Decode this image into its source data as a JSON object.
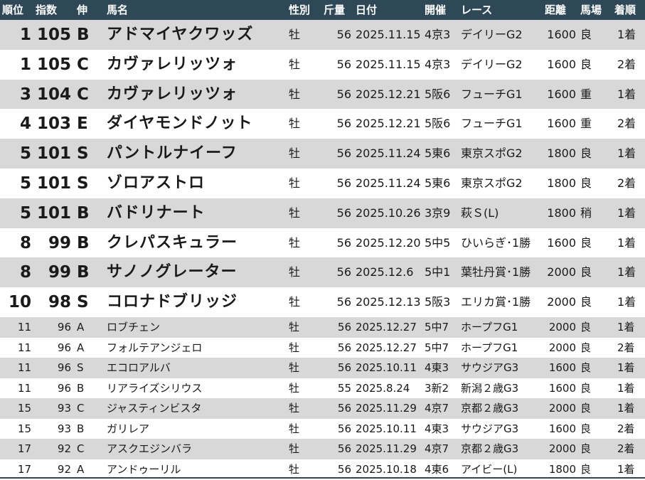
{
  "headers": {
    "rank": "順位",
    "index": "指数",
    "grade": "伸",
    "name": "馬名",
    "sex": "性別",
    "weight": "斤量",
    "date": "日付",
    "venue": "開催",
    "race": "レース",
    "distance": "距離",
    "track": "馬場",
    "finish": "着順"
  },
  "rows": [
    {
      "rank": "1",
      "index": "105",
      "grade": "B",
      "name": "アドマイヤクワッズ",
      "sex": "牡",
      "weight": "56",
      "date": "2025.11.15",
      "venue": "4京3",
      "race": "デイリーG2",
      "distance": "1600",
      "track": "良",
      "finish": "1着"
    },
    {
      "rank": "1",
      "index": "105",
      "grade": "C",
      "name": "カヴァレリッツォ",
      "sex": "牡",
      "weight": "56",
      "date": "2025.11.15",
      "venue": "4京3",
      "race": "デイリーG2",
      "distance": "1600",
      "track": "良",
      "finish": "2着"
    },
    {
      "rank": "3",
      "index": "104",
      "grade": "C",
      "name": "カヴァレリッツォ",
      "sex": "牡",
      "weight": "56",
      "date": "2025.12.21",
      "venue": "5阪6",
      "race": "フューチG1",
      "distance": "1600",
      "track": "重",
      "finish": "1着"
    },
    {
      "rank": "4",
      "index": "103",
      "grade": "E",
      "name": "ダイヤモンドノット",
      "sex": "牡",
      "weight": "56",
      "date": "2025.12.21",
      "venue": "5阪6",
      "race": "フューチG1",
      "distance": "1600",
      "track": "重",
      "finish": "2着"
    },
    {
      "rank": "5",
      "index": "101",
      "grade": "S",
      "name": "パントルナイーフ",
      "sex": "牡",
      "weight": "56",
      "date": "2025.11.24",
      "venue": "5東6",
      "race": "東京スポG2",
      "distance": "1800",
      "track": "良",
      "finish": "1着"
    },
    {
      "rank": "5",
      "index": "101",
      "grade": "S",
      "name": "ゾロアストロ",
      "sex": "牡",
      "weight": "56",
      "date": "2025.11.24",
      "venue": "5東6",
      "race": "東京スポG2",
      "distance": "1800",
      "track": "良",
      "finish": "2着"
    },
    {
      "rank": "5",
      "index": "101",
      "grade": "B",
      "name": "バドリナート",
      "sex": "牡",
      "weight": "56",
      "date": "2025.10.26",
      "venue": "3京9",
      "race": "萩Ｓ(L)",
      "distance": "1800",
      "track": "稍",
      "finish": "1着"
    },
    {
      "rank": "8",
      "index": "99",
      "grade": "B",
      "name": "クレパスキュラー",
      "sex": "牡",
      "weight": "56",
      "date": "2025.12.20",
      "venue": "5中5",
      "race": "ひいらぎ･1勝",
      "distance": "1600",
      "track": "良",
      "finish": "1着"
    },
    {
      "rank": "8",
      "index": "99",
      "grade": "B",
      "name": "サノノグレーター",
      "sex": "牡",
      "weight": "56",
      "date": "2025.12.6",
      "venue": "5中1",
      "race": "葉牡丹賞･1勝",
      "distance": "2000",
      "track": "良",
      "finish": "1着"
    },
    {
      "rank": "10",
      "index": "98",
      "grade": "S",
      "name": "コロナドブリッジ",
      "sex": "牡",
      "weight": "56",
      "date": "2025.12.13",
      "venue": "5阪3",
      "race": "エリカ賞･1勝",
      "distance": "2000",
      "track": "良",
      "finish": "1着"
    },
    {
      "rank": "11",
      "index": "96",
      "grade": "A",
      "name": "ロブチェン",
      "sex": "牡",
      "weight": "56",
      "date": "2025.12.27",
      "venue": "5中7",
      "race": "ホープフG1",
      "distance": "2000",
      "track": "良",
      "finish": "1着"
    },
    {
      "rank": "11",
      "index": "96",
      "grade": "A",
      "name": "フォルテアンジェロ",
      "sex": "牡",
      "weight": "56",
      "date": "2025.12.27",
      "venue": "5中7",
      "race": "ホープフG1",
      "distance": "2000",
      "track": "良",
      "finish": "2着"
    },
    {
      "rank": "11",
      "index": "96",
      "grade": "S",
      "name": "エコロアルバ",
      "sex": "牡",
      "weight": "56",
      "date": "2025.10.11",
      "venue": "4東3",
      "race": "サウジアG3",
      "distance": "1600",
      "track": "良",
      "finish": "1着"
    },
    {
      "rank": "11",
      "index": "96",
      "grade": "B",
      "name": "リアライズシリウス",
      "sex": "牡",
      "weight": "55",
      "date": "2025.8.24",
      "venue": "3新2",
      "race": "新潟２歳G3",
      "distance": "1600",
      "track": "良",
      "finish": "1着"
    },
    {
      "rank": "15",
      "index": "93",
      "grade": "C",
      "name": "ジャスティンビスタ",
      "sex": "牡",
      "weight": "56",
      "date": "2025.11.29",
      "venue": "4京7",
      "race": "京都２歳G3",
      "distance": "2000",
      "track": "良",
      "finish": "1着"
    },
    {
      "rank": "15",
      "index": "93",
      "grade": "B",
      "name": "ガリレア",
      "sex": "牡",
      "weight": "56",
      "date": "2025.10.11",
      "venue": "4東3",
      "race": "サウジアG3",
      "distance": "1600",
      "track": "良",
      "finish": "2着"
    },
    {
      "rank": "17",
      "index": "92",
      "grade": "C",
      "name": "アスクエジンバラ",
      "sex": "牡",
      "weight": "56",
      "date": "2025.11.29",
      "venue": "4京7",
      "race": "京都２歳G3",
      "distance": "2000",
      "track": "良",
      "finish": "2着"
    },
    {
      "rank": "17",
      "index": "92",
      "grade": "A",
      "name": "アンドゥーリル",
      "sex": "牡",
      "weight": "56",
      "date": "2025.10.18",
      "venue": "4東6",
      "race": "アイビー(L)",
      "distance": "1800",
      "track": "良",
      "finish": "1着"
    }
  ]
}
